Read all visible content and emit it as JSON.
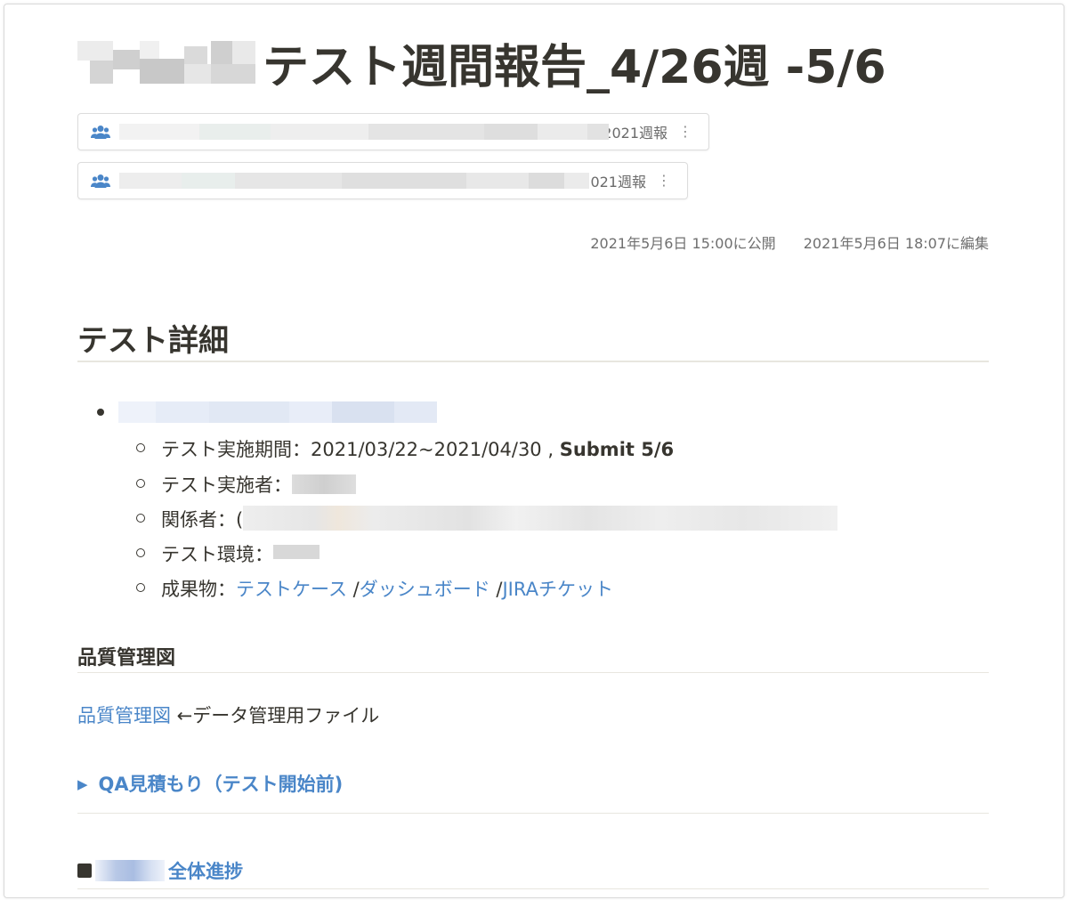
{
  "page": {
    "title": "テスト週間報告_4/26週 -5/6"
  },
  "links": [
    {
      "suffix": "t/2021週報",
      "menu": "⋮",
      "icon": "group-icon"
    },
    {
      "suffix": ":/2021週報",
      "menu": "⋮",
      "icon": "group-icon"
    }
  ],
  "meta": {
    "published": "2021年5月6日 15:00に公開",
    "edited": "2021年5月6日 18:07に編集"
  },
  "section_test_detail": {
    "heading": "テスト詳細",
    "items": {
      "period_prefix": "テスト実施期間：2021/03/22~2021/04/30 , ",
      "period_submit": "Submit 5/6",
      "executor": "テスト実施者：",
      "stakeholders": "関係者：(",
      "environment": "テスト環境：",
      "deliverables_prefix": "成果物：",
      "deliverable_links": [
        "テストケース",
        "ダッシュボード",
        "JIRAチケット"
      ],
      "separator": " /"
    }
  },
  "section_quality": {
    "heading": "品質管理図",
    "link": "品質管理図",
    "note": " ←データ管理用ファイル"
  },
  "toggle": {
    "label": "QA見積もり（テスト開始前)",
    "arrow": "▶"
  },
  "bottom": {
    "link": "全体進捗"
  },
  "colors": {
    "text": "#37352f",
    "link": "#4a86c8",
    "muted": "#6f6f6f",
    "rule": "#e8e6df"
  }
}
